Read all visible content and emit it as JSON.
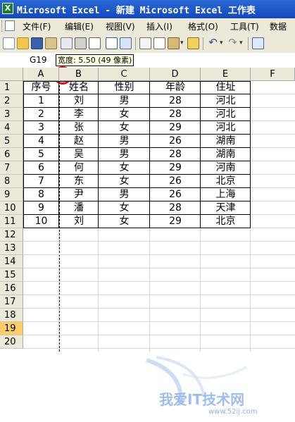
{
  "window": {
    "title": "Microsoft Excel - 新建 Microsoft Excel 工作表",
    "app_icon_letter": "X"
  },
  "menu": {
    "items": [
      "文件(F)",
      "编辑(E)",
      "视图(V)",
      "插入(I)",
      "格式(O)",
      "工具(T)",
      "数据"
    ]
  },
  "toolbar": {
    "icons": [
      "new-icon",
      "open-icon",
      "save-icon",
      "permission-icon",
      "email-icon",
      "print-icon",
      "print-preview-icon",
      "spelling-icon",
      "research-icon",
      "cut-icon",
      "copy-icon",
      "paste-icon",
      "format-painter-icon",
      "undo-icon",
      "redo-icon",
      "hyperlink-icon"
    ]
  },
  "formula_bar": {
    "name_box": "G19",
    "tooltip": "宽度: 5.50 (49 像素)"
  },
  "sheet": {
    "column_headers": [
      "A",
      "B",
      "C",
      "D",
      "E",
      "F"
    ],
    "row_headers": [
      "1",
      "2",
      "3",
      "4",
      "5",
      "6",
      "7",
      "8",
      "9",
      "10",
      "11",
      "12",
      "13",
      "14",
      "15",
      "16",
      "17",
      "18",
      "19",
      "20"
    ],
    "selected_row": "19",
    "rows": [
      [
        "序号",
        "姓名",
        "性别",
        "年龄",
        "住址"
      ],
      [
        "1",
        "刘",
        "男",
        "28",
        "河北"
      ],
      [
        "2",
        "李",
        "女",
        "28",
        "河北"
      ],
      [
        "3",
        "张",
        "女",
        "29",
        "河北"
      ],
      [
        "4",
        "赵",
        "男",
        "26",
        "湖南"
      ],
      [
        "5",
        "吴",
        "男",
        "28",
        "湖南"
      ],
      [
        "6",
        "何",
        "女",
        "29",
        "河南"
      ],
      [
        "7",
        "东",
        "女",
        "26",
        "北京"
      ],
      [
        "8",
        "尹",
        "男",
        "26",
        "上海"
      ],
      [
        "9",
        "潘",
        "女",
        "28",
        "天津"
      ],
      [
        "10",
        "刘",
        "女",
        "29",
        "北京"
      ]
    ]
  },
  "watermark": {
    "text": "我爱IT技术网",
    "url": "www.52ij.com"
  },
  "colors": {
    "title_bar": "#1448b8",
    "chrome": "#ece9d8",
    "selected_row": "#ffcc66",
    "highlight_circle": "#e0141e"
  }
}
